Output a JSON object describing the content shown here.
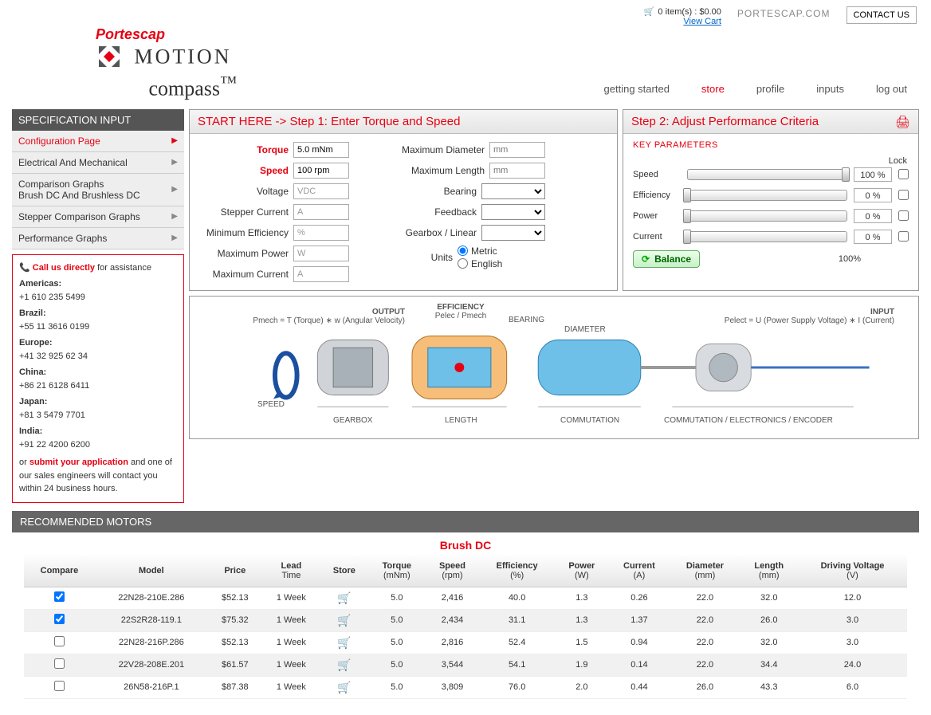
{
  "header": {
    "cart_summary": "0 item(s) : $0.00",
    "view_cart": "View Cart",
    "site_link": "PORTESCAP.COM",
    "contact_us": "CONTACT US",
    "brand_top": "Portescap",
    "brand_motion": "MOTION",
    "brand_compass": "compass",
    "tm": "™"
  },
  "nav": {
    "items": [
      "getting started",
      "store",
      "profile",
      "inputs",
      "log out"
    ],
    "active_index": 1
  },
  "sidebar": {
    "title": "SPECIFICATION INPUT",
    "items": [
      "Configuration Page",
      "Electrical And Mechanical",
      "Comparison Graphs\nBrush DC And Brushless DC",
      "Stepper Comparison Graphs",
      "Performance Graphs"
    ],
    "active_index": 0
  },
  "callbox": {
    "title": "Call us directly",
    "title_suffix": " for assistance",
    "regions": [
      {
        "name": "Americas:",
        "phone": "+1 610 235 5499"
      },
      {
        "name": "Brazil:",
        "phone": "+55 11 3616 0199"
      },
      {
        "name": "Europe:",
        "phone": "+41 32 925 62 34"
      },
      {
        "name": "China:",
        "phone": "+86 21 6128 6411"
      },
      {
        "name": "Japan:",
        "phone": "+81 3 5479 7701"
      },
      {
        "name": "India:",
        "phone": "+91 22 4200 6200"
      }
    ],
    "or": "or ",
    "submit": "submit your application",
    "tail": " and one of our sales engineers will contact you within 24 business hours."
  },
  "step1": {
    "title": "START HERE -> Step 1: Enter Torque and Speed",
    "left": [
      {
        "label": "Torque",
        "value": "5.0 mNm",
        "red": true
      },
      {
        "label": "Speed",
        "value": "100 rpm",
        "red": true
      },
      {
        "label": "Voltage",
        "value": "VDC"
      },
      {
        "label": "Stepper Current",
        "value": "A"
      },
      {
        "label": "Minimum Efficiency",
        "value": "%"
      },
      {
        "label": "Maximum Power",
        "value": "W"
      },
      {
        "label": "Maximum Current",
        "value": "A"
      }
    ],
    "right": [
      {
        "label": "Maximum Diameter",
        "type": "text",
        "placeholder": "mm"
      },
      {
        "label": "Maximum Length",
        "type": "text",
        "placeholder": "mm"
      },
      {
        "label": "Bearing",
        "type": "select"
      },
      {
        "label": "Feedback",
        "type": "select"
      },
      {
        "label": "Gearbox / Linear",
        "type": "select"
      }
    ],
    "units_label": "Units",
    "units_metric": "Metric",
    "units_english": "English"
  },
  "step2": {
    "title": "Step 2: Adjust Performance Criteria",
    "key_params": "KEY PARAMETERS",
    "lock": "Lock",
    "sliders": [
      {
        "label": "Speed",
        "pct": "100 %",
        "pos": 100
      },
      {
        "label": "Efficiency",
        "pct": "0 %",
        "pos": 0
      },
      {
        "label": "Power",
        "pct": "0 %",
        "pos": 0
      },
      {
        "label": "Current",
        "pct": "0 %",
        "pos": 0
      }
    ],
    "balance": "Balance",
    "total": "100%"
  },
  "diagram": {
    "output_head": "OUTPUT",
    "output_sub": "Pmech = T (Torque) ∗ w (Angular Velocity)",
    "efficiency_head": "EFFICIENCY",
    "efficiency_sub": "Pelec / Pmech",
    "bearing": "BEARING",
    "diameter": "DIAMETER",
    "input_head": "INPUT",
    "input_sub": "Pelect = U (Power Supply Voltage) ∗ I (Current)",
    "speed": "SPEED",
    "gearbox": "GEARBOX",
    "length": "LENGTH",
    "commutation": "COMMUTATION",
    "commutation_enc": "COMMUTATION / ELECTRONICS / ENCODER"
  },
  "reco": {
    "title": "RECOMMENDED MOTORS",
    "category": "Brush DC",
    "columns": [
      {
        "h": "Compare"
      },
      {
        "h": "Model"
      },
      {
        "h": "Price"
      },
      {
        "h": "Lead",
        "sub": "Time"
      },
      {
        "h": "Store"
      },
      {
        "h": "Torque",
        "sub": "(mNm)"
      },
      {
        "h": "Speed",
        "sub": "(rpm)"
      },
      {
        "h": "Efficiency",
        "sub": "(%)"
      },
      {
        "h": "Power",
        "sub": "(W)"
      },
      {
        "h": "Current",
        "sub": "(A)"
      },
      {
        "h": "Diameter",
        "sub": "(mm)"
      },
      {
        "h": "Length",
        "sub": "(mm)"
      },
      {
        "h": "Driving Voltage",
        "sub": "(V)"
      }
    ],
    "rows": [
      {
        "checked": true,
        "model": "22N28-210E.286",
        "price": "$52.13",
        "lead": "1 Week",
        "torque": "5.0",
        "speed": "2,416",
        "eff": "40.0",
        "power": "1.3",
        "current": "0.26",
        "dia": "22.0",
        "len": "32.0",
        "volt": "12.0"
      },
      {
        "checked": true,
        "model": "22S2R28-119.1",
        "price": "$75.32",
        "lead": "1 Week",
        "torque": "5.0",
        "speed": "2,434",
        "eff": "31.1",
        "power": "1.3",
        "current": "1.37",
        "dia": "22.0",
        "len": "26.0",
        "volt": "3.0"
      },
      {
        "checked": false,
        "model": "22N28-216P.286",
        "price": "$52.13",
        "lead": "1 Week",
        "torque": "5.0",
        "speed": "2,816",
        "eff": "52.4",
        "power": "1.5",
        "current": "0.94",
        "dia": "22.0",
        "len": "32.0",
        "volt": "3.0"
      },
      {
        "checked": false,
        "model": "22V28-208E.201",
        "price": "$61.57",
        "lead": "1 Week",
        "torque": "5.0",
        "speed": "3,544",
        "eff": "54.1",
        "power": "1.9",
        "current": "0.14",
        "dia": "22.0",
        "len": "34.4",
        "volt": "24.0"
      },
      {
        "checked": false,
        "model": "26N58-216P.1",
        "price": "$87.38",
        "lead": "1 Week",
        "torque": "5.0",
        "speed": "3,809",
        "eff": "76.0",
        "power": "2.0",
        "current": "0.44",
        "dia": "26.0",
        "len": "43.3",
        "volt": "6.0"
      }
    ]
  }
}
